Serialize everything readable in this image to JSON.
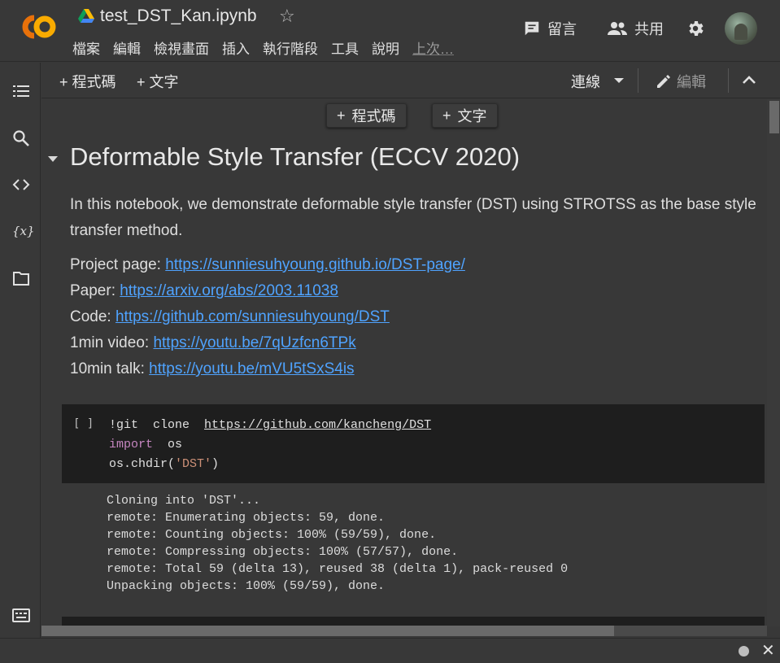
{
  "app": {
    "name": "Colaboratory",
    "logo_text": "CO"
  },
  "header": {
    "title": "test_DST_Kan.ipynb",
    "menu": [
      "檔案",
      "編輯",
      "檢視畫面",
      "插入",
      "執行階段",
      "工具",
      "說明",
      "上次…"
    ],
    "comment_label": "留言",
    "share_label": "共用"
  },
  "toolbar": {
    "add_code": "+ 程式碼",
    "add_text": "+ 文字",
    "connect": "連線",
    "edit": "編輯"
  },
  "cell_insert": {
    "code": "程式碼",
    "text": "文字",
    "plus": "+"
  },
  "notebook": {
    "heading": "Deformable Style Transfer (ECCV 2020)",
    "intro": "In this notebook, we demonstrate deformable style transfer (DST) using STROTSS as the base style transfer method.",
    "links": [
      {
        "label": "Project page:",
        "url": "https://sunniesuhyoung.github.io/DST-page/"
      },
      {
        "label": "Paper:",
        "url": "https://arxiv.org/abs/2003.11038"
      },
      {
        "label": "Code:",
        "url": "https://github.com/sunniesuhyoung/DST"
      },
      {
        "label": "1min video:",
        "url": "https://youtu.be/7qUzfcn6TPk"
      },
      {
        "label": "10min talk:",
        "url": "https://youtu.be/mVU5tSxS4is"
      }
    ],
    "code_cell": {
      "run_indicator": "[ ]",
      "line1_cmd": "!git  clone  ",
      "line1_url": "https://github.com/kancheng/DST",
      "line2_kw": "import",
      "line2_rest": "  os",
      "line3_pre": "os.chdir(",
      "line3_str": "'DST'",
      "line3_post": ")"
    },
    "output": [
      "Cloning into 'DST'...",
      "remote: Enumerating objects: 59, done.",
      "remote: Counting objects: 100% (59/59), done.",
      "remote: Compressing objects: 100% (57/57), done.",
      "remote: Total 59 (delta 13), reused 38 (delta 1), pack-reused 0",
      "Unpacking objects: 100% (59/59), done."
    ]
  },
  "colors": {
    "link": "#4fa3ff",
    "keyword": "#c586c0",
    "string": "#ce9178",
    "logo_orange": "#f9ab00",
    "logo_amber": "#e8710a"
  }
}
